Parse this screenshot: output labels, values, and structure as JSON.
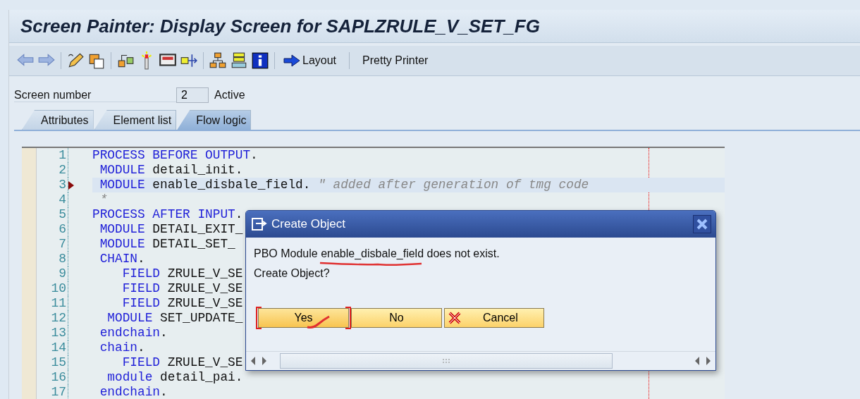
{
  "window": {
    "title": "Screen Painter: Display Screen for SAPLZRULE_V_SET_FG"
  },
  "toolbar": {
    "text_buttons": [
      {
        "kind": "arrow",
        "label": "Layout"
      },
      {
        "kind": "plain",
        "label": "Pretty Printer"
      }
    ]
  },
  "screen_number": {
    "label": "Screen number",
    "value": "2",
    "status": "Active"
  },
  "tabs": [
    {
      "label": "Attributes",
      "selected": false
    },
    {
      "label": "Element list",
      "selected": false
    },
    {
      "label": "Flow logic",
      "selected": true
    }
  ],
  "editor": {
    "lines": [
      {
        "number": "1",
        "current": false,
        "tokens": [
          {
            "kind": "keyword",
            "text": "PROCESS BEFORE OUTPUT"
          },
          {
            "kind": "plain",
            "text": "."
          }
        ]
      },
      {
        "number": "2",
        "current": false,
        "tokens": [
          {
            "kind": "keyword",
            "text": " MODULE"
          },
          {
            "kind": "plain",
            "text": " detail_init."
          }
        ]
      },
      {
        "number": "3",
        "current": true,
        "tokens": [
          {
            "kind": "keyword",
            "text": " MODULE"
          },
          {
            "kind": "plain",
            "text": " enable_disbale_field. "
          },
          {
            "kind": "comment",
            "text": "\" added after generation of tmg code"
          }
        ]
      },
      {
        "number": "4",
        "current": false,
        "tokens": [
          {
            "kind": "comment",
            "text": " *"
          }
        ]
      },
      {
        "number": "5",
        "current": false,
        "tokens": [
          {
            "kind": "keyword",
            "text": "PROCESS AFTER INPUT"
          },
          {
            "kind": "plain",
            "text": "."
          }
        ]
      },
      {
        "number": "6",
        "current": false,
        "tokens": [
          {
            "kind": "keyword",
            "text": " MODULE"
          },
          {
            "kind": "plain",
            "text": " DETAIL_EXIT_"
          }
        ]
      },
      {
        "number": "7",
        "current": false,
        "tokens": [
          {
            "kind": "keyword",
            "text": " MODULE"
          },
          {
            "kind": "plain",
            "text": " DETAIL_SET_"
          }
        ]
      },
      {
        "number": "8",
        "current": false,
        "tokens": [
          {
            "kind": "keyword",
            "text": " CHAIN"
          },
          {
            "kind": "plain",
            "text": "."
          }
        ]
      },
      {
        "number": "9",
        "current": false,
        "tokens": [
          {
            "kind": "keyword",
            "text": "    FIELD"
          },
          {
            "kind": "plain",
            "text": " ZRULE_V_SE"
          }
        ]
      },
      {
        "number": "10",
        "current": false,
        "tokens": [
          {
            "kind": "keyword",
            "text": "    FIELD"
          },
          {
            "kind": "plain",
            "text": " ZRULE_V_SE"
          }
        ]
      },
      {
        "number": "11",
        "current": false,
        "tokens": [
          {
            "kind": "keyword",
            "text": "    FIELD"
          },
          {
            "kind": "plain",
            "text": " ZRULE_V_SE"
          }
        ]
      },
      {
        "number": "12",
        "current": false,
        "tokens": [
          {
            "kind": "keyword",
            "text": "  MODULE"
          },
          {
            "kind": "plain",
            "text": " SET_UPDATE_"
          }
        ]
      },
      {
        "number": "13",
        "current": false,
        "tokens": [
          {
            "kind": "keyword",
            "text": " endchain"
          },
          {
            "kind": "plain",
            "text": "."
          }
        ]
      },
      {
        "number": "14",
        "current": false,
        "tokens": [
          {
            "kind": "keyword",
            "text": " chain"
          },
          {
            "kind": "plain",
            "text": "."
          }
        ]
      },
      {
        "number": "15",
        "current": false,
        "tokens": [
          {
            "kind": "keyword",
            "text": "    FIELD"
          },
          {
            "kind": "plain",
            "text": " ZRULE_V_SE"
          }
        ]
      },
      {
        "number": "16",
        "current": false,
        "tokens": [
          {
            "kind": "keyword",
            "text": "  module"
          },
          {
            "kind": "plain",
            "text": " detail_pai."
          }
        ]
      },
      {
        "number": "17",
        "current": false,
        "tokens": [
          {
            "kind": "keyword",
            "text": " endchain"
          },
          {
            "kind": "plain",
            "text": "."
          }
        ]
      }
    ]
  },
  "dialog": {
    "title": "Create Object",
    "message": "PBO Module enable_disbale_field does not exist.",
    "question": "Create Object?",
    "buttons": [
      {
        "label": "Yes",
        "kind": "plain",
        "focused": true
      },
      {
        "label": "No",
        "kind": "plain",
        "focused": false
      },
      {
        "label": "Cancel",
        "kind": "cancel",
        "focused": false
      }
    ]
  }
}
